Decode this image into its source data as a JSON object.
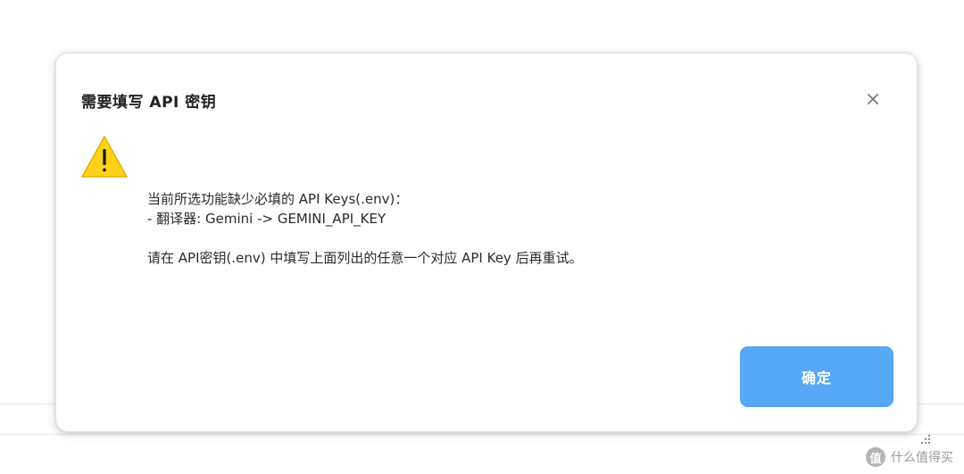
{
  "dialog": {
    "title": "需要填写 API 密钥",
    "close_icon": "close-icon",
    "warning_icon": "warning-triangle-icon",
    "message_lines": [
      "当前所选功能缺少必填的 API Keys(.env)：",
      "- 翻译器: Gemini -> GEMINI_API_KEY"
    ],
    "instruction": "请在 API密钥(.env) 中填写上面列出的任意一个对应 API Key 后再重试。",
    "ok_label": "确定"
  },
  "watermark": {
    "logo_char": "值",
    "text": "什么值得买"
  },
  "colors": {
    "ok_button": "#57a8f6",
    "warning_fill": "#ffd21a",
    "warning_border": "#e0b100"
  }
}
